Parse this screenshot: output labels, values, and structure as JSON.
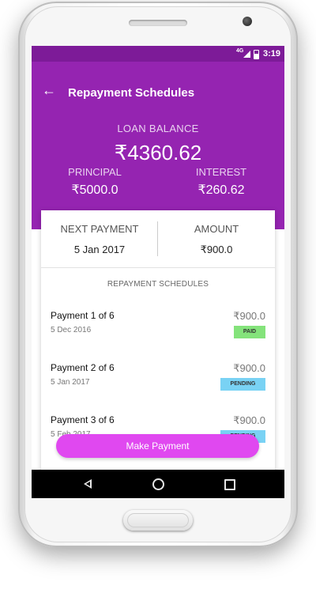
{
  "status_bar": {
    "network": "4G",
    "time": "3:19"
  },
  "app_bar": {
    "title": "Repayment Schedules",
    "back_icon": "arrow-back-icon"
  },
  "summary": {
    "loan_balance_label": "LOAN BALANCE",
    "loan_balance_value": "₹4360.62",
    "principal_label": "PRINCIPAL",
    "principal_value": "₹5000.0",
    "interest_label": "INTEREST",
    "interest_value": "₹260.62"
  },
  "next_payment": {
    "label": "NEXT PAYMENT",
    "date": "5 Jan 2017",
    "amount_label": "AMOUNT",
    "amount": "₹900.0"
  },
  "schedule": {
    "heading": "REPAYMENT SCHEDULES",
    "rows": [
      {
        "name": "Payment 1 of 6",
        "date": "5 Dec 2016",
        "amount": "₹900.0",
        "status": "PAID"
      },
      {
        "name": "Payment 2 of 6",
        "date": "5 Jan 2017",
        "amount": "₹900.0",
        "status": "PENDING"
      },
      {
        "name": "Payment 3 of 6",
        "date": "5 Feb 2017",
        "amount": "₹900.0",
        "status": "PENDING"
      }
    ]
  },
  "actions": {
    "make_payment_label": "Make Payment"
  },
  "colors": {
    "header": "#9524b1",
    "status_bar": "#7d1b98",
    "button": "#e048f0",
    "paid_badge": "#84e37b",
    "pending_badge": "#79d2f4"
  },
  "nav_icons": [
    "nav-back-icon",
    "nav-home-icon",
    "nav-recent-icon"
  ]
}
